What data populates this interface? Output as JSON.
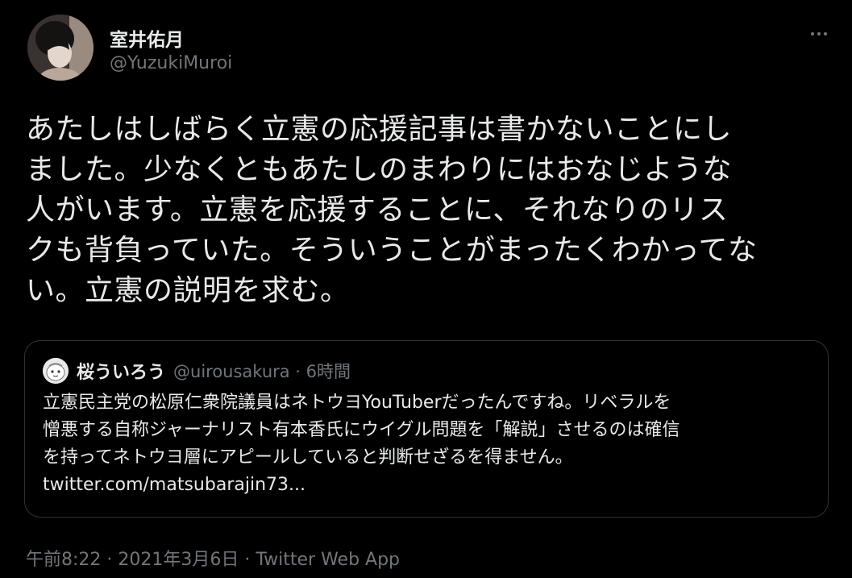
{
  "author": {
    "display_name": "室井佑月",
    "handle": "@YuzukiMuroi"
  },
  "tweet": {
    "text": "あたしはしばらく立憲の応援記事は書かないことにし\nました。少なくともあたしのまわりにはおなじような\n人がいます。立憲を応援することに、それなりのリス\nクも背負っていた。そういうことがまったくわかってな\nい。立憲の説明を求む。"
  },
  "quoted": {
    "display_name": "桜ういろう",
    "meta": "@uirousakura · 6時間",
    "text": "立憲民主党の松原仁衆院議員はネトウヨYouTuberだったんですね。リベラルを\n憎悪する自称ジャーナリスト有本香氏にウイグル問題を「解説」させるのは確信\nを持ってネトウヨ層にアピールしていると判断せざるを得ません。\ntwitter.com/matsubarajin73..."
  },
  "footer": {
    "timestamp": "午前8:22 · 2021年3月6日",
    "separator": " · ",
    "source": "Twitter Web App"
  },
  "icons": {
    "more": "more-horizontal-icon"
  },
  "colors": {
    "background": "#000000",
    "text_primary": "#e7e9ea",
    "text_secondary": "#71767b",
    "border": "#2f3336"
  }
}
